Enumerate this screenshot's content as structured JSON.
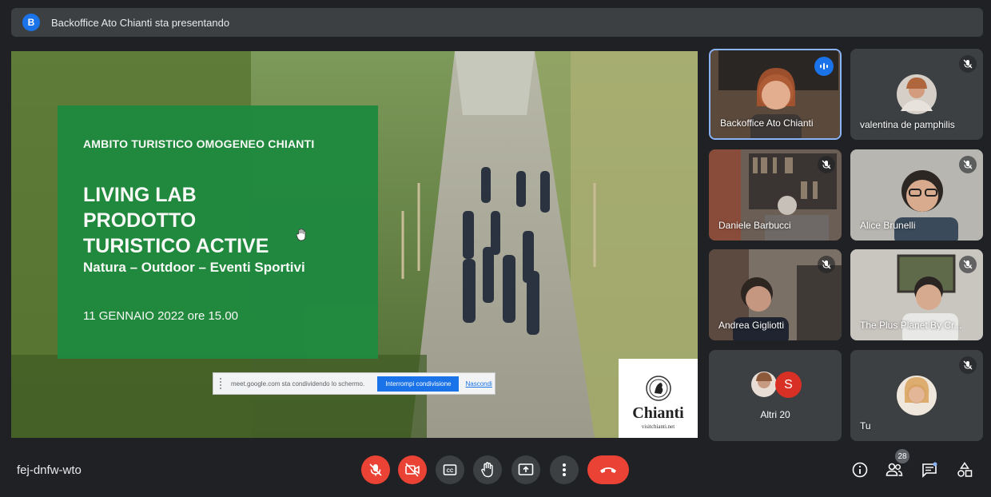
{
  "presenter_bar": {
    "avatar_letter": "B",
    "title": "Backoffice Ato Chianti sta presentando"
  },
  "slide": {
    "kicker": "AMBITO TURISTICO OMOGENEO CHIANTI",
    "headline_1": "LIVING LAB",
    "headline_2": "PRODOTTO",
    "headline_3": "TURISTICO ACTIVE",
    "subtitle": "Natura – Outdoor – Eventi Sportivi",
    "date": "11 GENNAIO 2022 ore 15.00",
    "logo_brand": "Chianti",
    "logo_site": "visitchianti.net"
  },
  "share_bar": {
    "text": "meet.google.com sta condividendo lo schermo.",
    "stop_label": "Interrompi condivisione",
    "hide_label": "Nascondi"
  },
  "participants": [
    {
      "name": "Backoffice Ato Chianti"
    },
    {
      "name": "valentina de pamphilis"
    },
    {
      "name": "Daniele Barbucci"
    },
    {
      "name": "Alice Brunelli"
    },
    {
      "name": "Andrea Gigliotti"
    },
    {
      "name": "The Plus Planet By Cr..."
    },
    {
      "name": "Altri 20",
      "avatar_letter": "S"
    },
    {
      "name": "Tu"
    }
  ],
  "bottom_bar": {
    "meeting_code": "fej-dnfw-wto",
    "participants_count": "28"
  },
  "colors": {
    "accent": "#1a73e8",
    "danger": "#ea4335",
    "bg": "#202124",
    "tile": "#3c4043"
  }
}
